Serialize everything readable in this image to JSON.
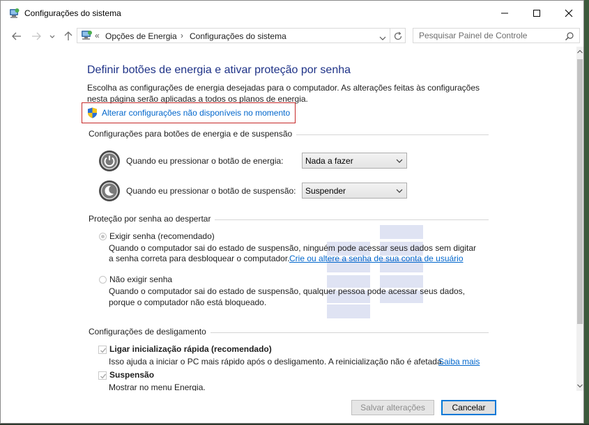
{
  "window": {
    "title": "Configurações do sistema",
    "controls": [
      "minimize-icon",
      "maximize-icon",
      "close-icon"
    ]
  },
  "nav": {
    "breadcrumb_prefix": "«",
    "breadcrumbs": [
      "Opções de Energia",
      "Configurações do sistema"
    ],
    "search_placeholder": "Pesquisar Painel de Controle"
  },
  "main": {
    "heading": "Definir botões de energia e ativar proteção por senha",
    "description": "Escolha as configurações de energia desejadas para o computador. As alterações feitas às configurações nesta página serão aplicadas a todos os planos de energia.",
    "change_settings_link": "Alterar configurações não disponíveis no momento",
    "power_section": {
      "title": "Configurações para botões de energia e de suspensão",
      "rows": [
        {
          "label": "Quando eu pressionar o botão de energia:",
          "value": "Nada a fazer",
          "icon": "power-button-icon"
        },
        {
          "label": "Quando eu pressionar o botão de suspensão:",
          "value": "Suspender",
          "icon": "sleep-button-icon"
        }
      ]
    },
    "password_section": {
      "title": "Proteção por senha ao despertar",
      "require": {
        "label": "Exigir senha (recomendado)",
        "selected": true,
        "desc_line1": "Quando o computador sai do estado de suspensão, ninguém pode acessar seus dados sem digitar",
        "desc_line2": "a senha correta para desbloquear o computador.",
        "link": "Crie ou altere a senha de sua conta de usuário"
      },
      "no_require": {
        "label": "Não exigir senha",
        "selected": false,
        "desc_line1": "Quando o computador sai do estado de suspensão, qualquer pessoa pode acessar seus dados,",
        "desc_line2": "porque o computador não está bloqueado."
      }
    },
    "shutdown_section": {
      "title": "Configurações de desligamento",
      "fast_startup": {
        "label": "Ligar inicialização rápida (recomendado)",
        "checked": true,
        "desc": "Isso ajuda a iniciar o PC mais rápido após o desligamento. A reinicialização não é afetada.",
        "link": "Saiba mais"
      },
      "sleep": {
        "label": "Suspensão",
        "checked": true,
        "desc": "Mostrar no menu Energia."
      }
    }
  },
  "footer": {
    "save_label": "Salvar alterações",
    "cancel_label": "Cancelar"
  },
  "colors": {
    "heading": "#1e3287",
    "link": "#0066cc",
    "highlight_border": "#c62828",
    "disabled_text": "#8a8a8a"
  }
}
